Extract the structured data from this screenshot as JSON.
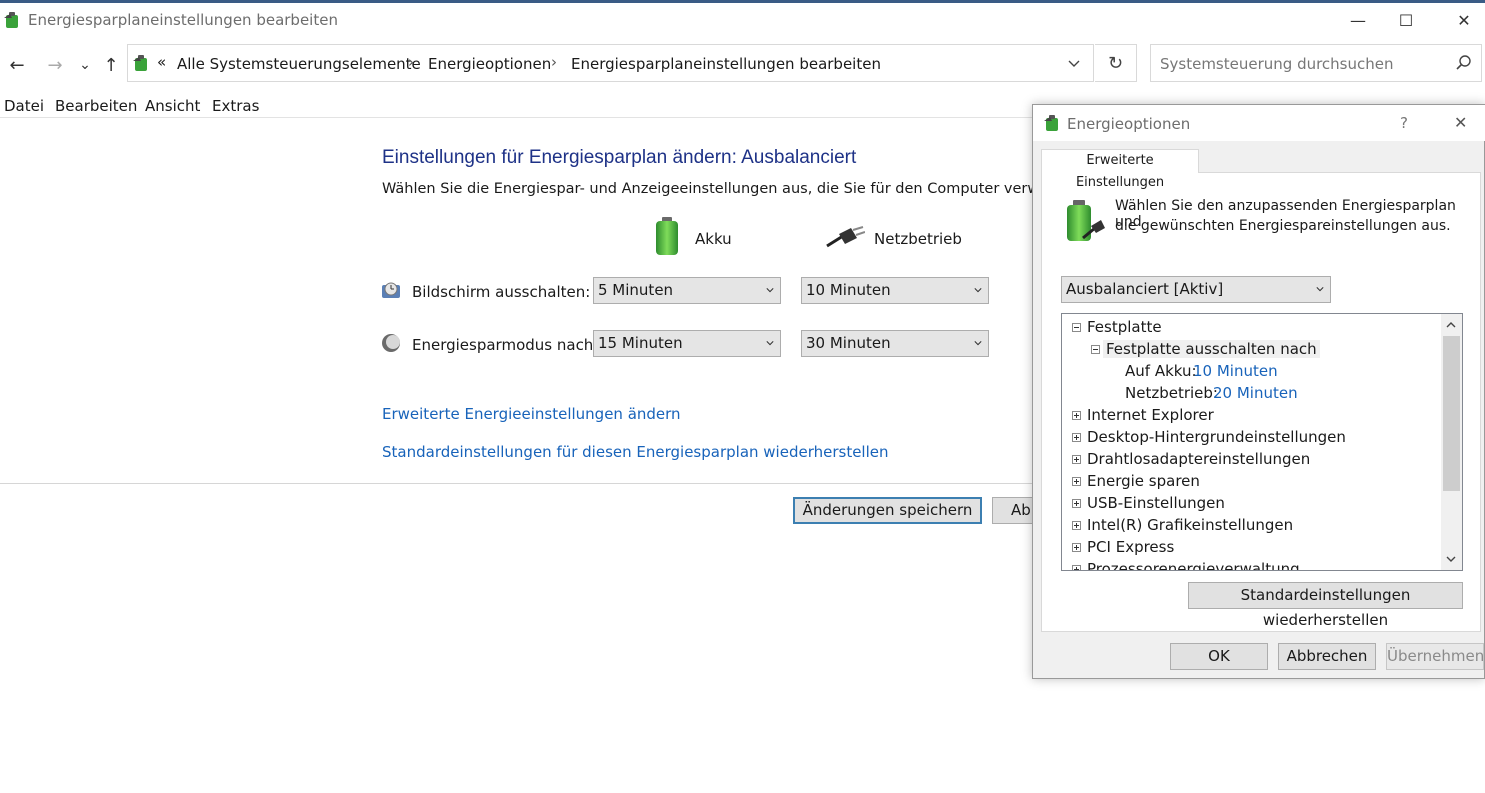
{
  "window": {
    "title": "Energiesparplaneinstellungen bearbeiten",
    "controls": {
      "minimize": "—",
      "maximize": "☐",
      "close": "✕"
    }
  },
  "nav": {
    "back": "←",
    "forward": "→",
    "recent": "⌄",
    "up": "↑",
    "overflow": "«",
    "breadcrumbs": [
      "Alle Systemsteuerungselemente",
      "Energieoptionen",
      "Energiesparplaneinstellungen bearbeiten"
    ],
    "separator": "›",
    "refresh": "↻",
    "search_placeholder": "Systemsteuerung durchsuchen"
  },
  "menu": [
    "Datei",
    "Bearbeiten",
    "Ansicht",
    "Extras"
  ],
  "main": {
    "heading": "Einstellungen für Energiesparplan ändern: Ausbalanciert",
    "subtext": "Wählen Sie die Energiespar- und Anzeigeeinstellungen aus, die Sie für den Computer verwenden m",
    "col_battery": "Akku",
    "col_plugged": "Netzbetrieb",
    "rows": [
      {
        "label": "Bildschirm ausschalten:",
        "battery": "5 Minuten",
        "plugged": "10 Minuten"
      },
      {
        "label": "Energiesparmodus nach:",
        "battery": "15 Minuten",
        "plugged": "30 Minuten"
      }
    ],
    "link_advanced": "Erweiterte Energieeinstellungen ändern",
    "link_restore": "Standardeinstellungen für diesen Energiesparplan wiederherstellen",
    "save_button": "Änderungen speichern",
    "cancel_button": "Ab"
  },
  "dialog": {
    "title": "Energieoptionen",
    "help": "?",
    "close": "✕",
    "tab": "Erweiterte Einstellungen",
    "description_line1": "Wählen Sie den anzupassenden Energiesparplan und",
    "description_line2": "die gewünschten Energiespareinstellungen aus.",
    "plan_select": "Ausbalanciert [Aktiv]",
    "tree": {
      "festplatte": "Festplatte",
      "festplatte_aus": "Festplatte ausschalten nach",
      "auf_akku_label": "Auf Akku:",
      "auf_akku_value": "10 Minuten",
      "netz_label": "Netzbetrieb:",
      "netz_value": "20 Minuten",
      "items": [
        "Internet Explorer",
        "Desktop-Hintergrundeinstellungen",
        "Drahtlosadaptereinstellungen",
        "Energie sparen",
        "USB-Einstellungen",
        "Intel(R) Grafikeinstellungen",
        "PCI Express",
        "Prozessorenergieverwaltung"
      ]
    },
    "restore_button": "Standardeinstellungen wiederherstellen",
    "ok_button": "OK",
    "cancel_button": "Abbrechen",
    "apply_button": "Übernehmen"
  }
}
